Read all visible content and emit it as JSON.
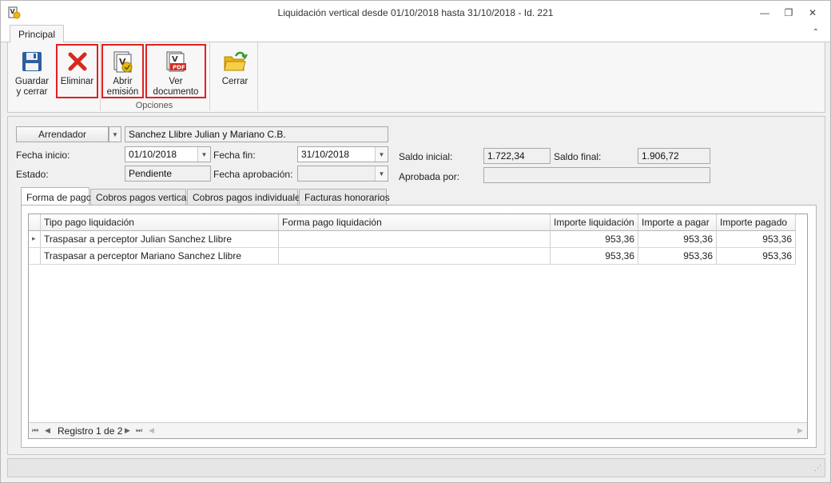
{
  "window": {
    "title": "Liquidación vertical desde 01/10/2018 hasta 31/10/2018 - Id. 221",
    "minimize_glyph": "—",
    "restore_glyph": "❐",
    "close_glyph": "✕"
  },
  "ribbon": {
    "tab_label": "Principal",
    "collapse_glyph": "⌃",
    "buttons": [
      {
        "label_line1": "Guardar",
        "label_line2": "y cerrar",
        "icon": "floppy-disk-icon"
      },
      {
        "label_line1": "Eliminar",
        "label_line2": "",
        "icon": "red-x-icon"
      },
      {
        "label_line1": "Abrir",
        "label_line2": "emisión",
        "icon": "open-emission-icon"
      },
      {
        "label_line1": "Ver documento",
        "label_line2": "",
        "icon": "pdf-document-icon"
      },
      {
        "label_line1": "Cerrar",
        "label_line2": "",
        "icon": "folder-close-icon"
      }
    ],
    "group_label": "Opciones",
    "highlight_color": "#e02020"
  },
  "form": {
    "party_type": "Arrendador",
    "party_name": "Sanchez Llibre Julian y Mariano C.B.",
    "fecha_inicio_label": "Fecha inicio:",
    "fecha_inicio": "01/10/2018",
    "fecha_fin_label": "Fecha fin:",
    "fecha_fin": "31/10/2018",
    "saldo_inicial_label": "Saldo inicial:",
    "saldo_inicial": "1.722,34",
    "saldo_final_label": "Saldo final:",
    "saldo_final": "1.906,72",
    "estado_label": "Estado:",
    "estado": "Pendiente",
    "fecha_aprobacion_label": "Fecha aprobación:",
    "fecha_aprobacion": "",
    "aprobada_por_label": "Aprobada por:",
    "aprobada_por": ""
  },
  "tabs": [
    {
      "label": "Forma de pago"
    },
    {
      "label": "Cobros pagos vertical"
    },
    {
      "label": "Cobros pagos individuales"
    },
    {
      "label": "Facturas honorarios"
    }
  ],
  "grid": {
    "columns": [
      "Tipo pago liquidación",
      "Forma pago liquidación",
      "Importe liquidación",
      "Importe a pagar",
      "Importe pagado"
    ],
    "rows": [
      {
        "tipo": "Traspasar a perceptor Julian Sanchez Llibre",
        "forma": "",
        "importe_liq": "953,36",
        "importe_pagar": "953,36",
        "importe_pagado": "953,36"
      },
      {
        "tipo": "Traspasar a perceptor Mariano Sanchez Llibre",
        "forma": "",
        "importe_liq": "953,36",
        "importe_pagar": "953,36",
        "importe_pagado": "953,36"
      }
    ],
    "row_indicator": "▸",
    "navigator": {
      "record_text": "Registro 1 de 2"
    }
  }
}
